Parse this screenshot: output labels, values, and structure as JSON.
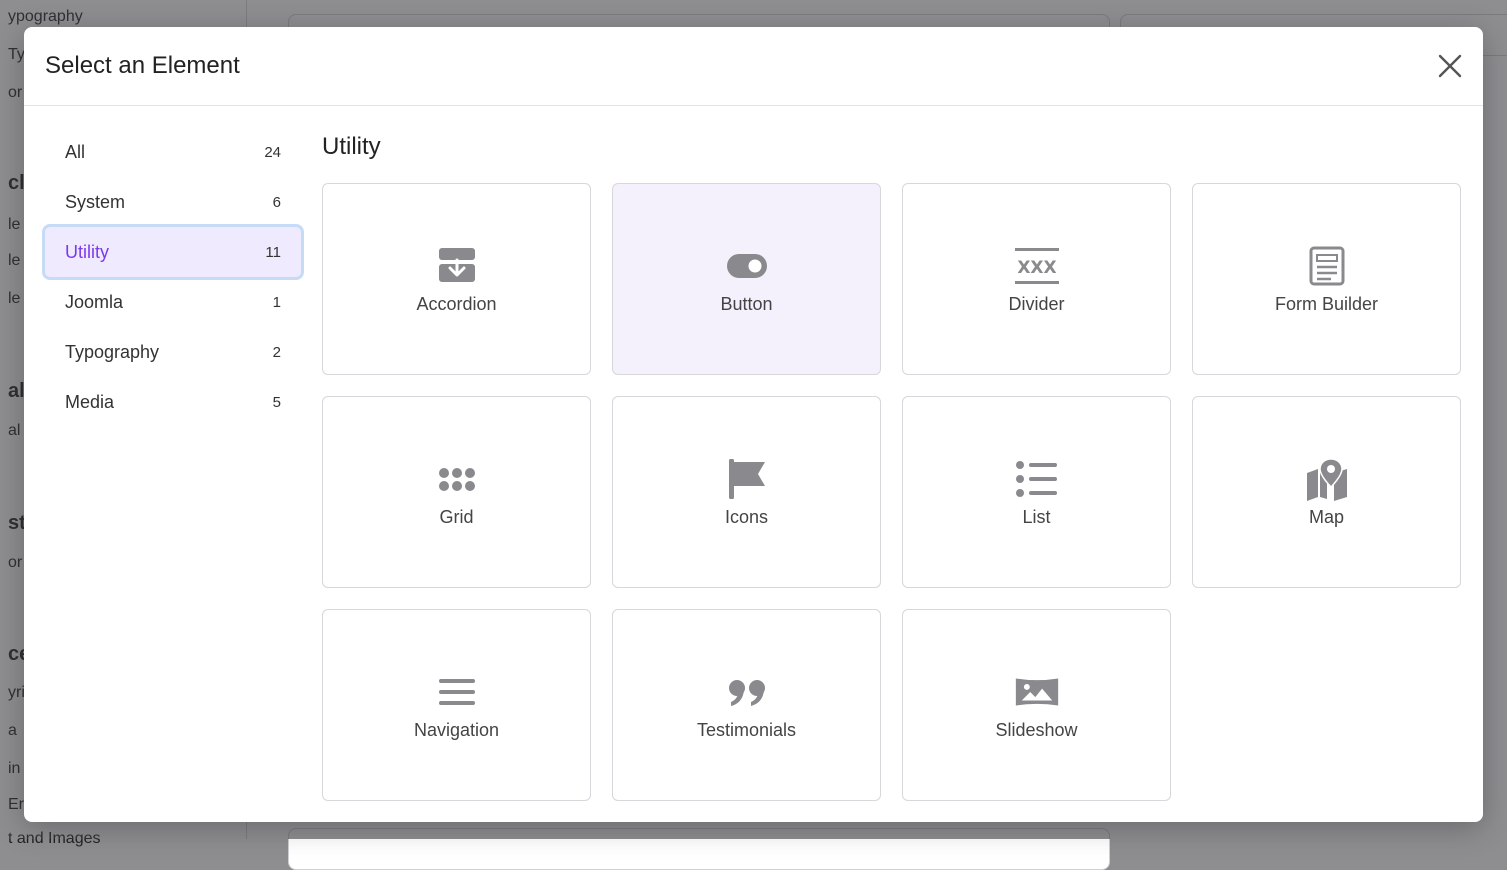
{
  "background_page": {
    "lines": [
      "ypography",
      "Ty",
      "or",
      "cl",
      "le",
      "le",
      "le",
      "al",
      "al",
      "st",
      "or",
      "ce",
      "yri",
      "a",
      "in",
      "Er",
      "t and Images"
    ]
  },
  "modal": {
    "title": "Select an Element",
    "close_label": "×"
  },
  "categories": [
    {
      "label": "All",
      "count": "24"
    },
    {
      "label": "System",
      "count": "6"
    },
    {
      "label": "Utility",
      "count": "11"
    },
    {
      "label": "Joomla",
      "count": "1"
    },
    {
      "label": "Typography",
      "count": "2"
    },
    {
      "label": "Media",
      "count": "5"
    }
  ],
  "active_category": "Utility",
  "section": {
    "title": "Utility"
  },
  "elements": [
    {
      "label": "Accordion",
      "icon": "accordion-icon"
    },
    {
      "label": "Button",
      "icon": "button-toggle-icon"
    },
    {
      "label": "Divider",
      "icon": "divider-icon"
    },
    {
      "label": "Form Builder",
      "icon": "form-builder-icon"
    },
    {
      "label": "Grid",
      "icon": "grid-icon"
    },
    {
      "label": "Icons",
      "icon": "flag-icon"
    },
    {
      "label": "List",
      "icon": "list-icon"
    },
    {
      "label": "Map",
      "icon": "map-icon"
    },
    {
      "label": "Navigation",
      "icon": "hamburger-icon"
    },
    {
      "label": "Testimonials",
      "icon": "quote-icon"
    },
    {
      "label": "Slideshow",
      "icon": "image-icon"
    }
  ],
  "colors": {
    "accent": "#7c3aed",
    "active_bg": "#efeafd",
    "active_border": "#c6dcf6",
    "icon_gray": "#8a8a8e"
  }
}
